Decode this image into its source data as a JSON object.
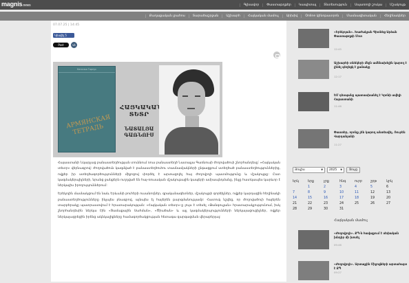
{
  "site": {
    "logo": "magnis",
    "logo_suffix": ".news"
  },
  "top_nav": [
    "Գլխավոր",
    "Փաստաթղթեր",
    "Կապիտալ",
    "Տնտեսություն",
    "Սպառողի շուկա",
    "Մշակույթ"
  ],
  "sub_nav": [
    "Քաղաքական լրահոս",
    "Տարածաշրջան",
    "Աշխարհ",
    "Հայկական մամուլ",
    "Արխիվ",
    "Online կինոթատրոն",
    "Մասնագիտական",
    "Հեղինակներ"
  ],
  "article": {
    "date": "07.07.25 | 14:45",
    "share": {
      "fb": "Կիսվել 5",
      "x": "Post",
      "vk": "vk"
    },
    "hero": {
      "book_author": "Наталья Гарнус",
      "book_title": "АРМЯНСКАЯ ТЕТРАДЬ",
      "armenian_line1": "ՀԱՅԿԱԿԱՆ",
      "armenian_line2": "ՏԵՏՐ",
      "armenian_line3": "ՆԱՏԱԼՅԱ",
      "armenian_line4": "ԳԱՌՆՈՒՍ"
    },
    "paragraphs": [
      "Հայաստանի Նկարչաց բանաստեղծության տուննում ռուս բանաստեղծ Նատալյա Գառնուսի ժողովածուի շնորհանդեսը՝ «Հայկական տետր» վերնագրով: Ժողովածուն կազմված է բանաստեղծուհու տասնամյակների ընթացքում ստեղծած բանաստեղծություններից, ովքեր իր ստեղծագործությունների միջոցով փորձել է արտացոլել հայ ժողովրդի պատմությունը և մշակույթը: Ըստ կազմակերպիչների, նրանց ջանքերն ուղղված են հայ-ռուսական մշակութային կապերի ամրապնդմանը, ինչը հատկապես կարևոր է ներկայիս իրողություններում:",
      "Երեկոյին մասնակցում են նաև Երևանի բուհերի ուսանողներ, գրականագետներ, մշակույթի գործիչներ, ովքեր կարդացին հեղինակի բանաստեղծությունները ինչպես բնագրով, այնպես էլ հայերեն թարգմանությամբ: Հատուկ նշվեց, որ ժողովածուի հայերեն տարբերակը պատրաստվում է հրատարակության: «Հայկական տետր»-ը լույս է տեսել «Ջանգուլյան» հրատարակչությունում, իսկ շնորհանդեսին ներկա էին «Ցամաքային Սահման», «Ծիածան» և այլ կազմակերպությունների ներկայացուցիչներ, ովքեր ներկայացրեցին իրենց ակնկալիքները համագործակցության հետագա զարգացման վերաբերյալ:"
    ]
  },
  "sidebar_news": [
    {
      "title": "«Երեկոյան». Խաժակյան Գիտնեց Արձան Փաստաթղթի Մոտ",
      "time": "12:45"
    },
    {
      "title": "Աշխարհի տնեկերի մեջն ամենախելին կարող է լինել գեղեցկ է քանակը",
      "time": "12:17"
    },
    {
      "title": "ԵՄ դեսպանը պատասխանել է Կրոնի ավելի Հայաստանի",
      "time": "11:46"
    },
    {
      "title": "Փաստեր, որոնք չեն կարող անտեսվել. Ռուբեն Վարդանյանի",
      "time": "11:27"
    }
  ],
  "archive_filter": {
    "month": "Յուլիս",
    "year": "2025",
    "button": "Ցույց"
  },
  "calendar": {
    "weekdays": [
      "երկ",
      "երք",
      "չրք",
      "հնգ",
      "ուրբ",
      "շբթ",
      "կրկ"
    ],
    "weeks": [
      [
        "",
        "1",
        "2",
        "3",
        "4",
        "5",
        "6"
      ],
      [
        "7",
        "8",
        "9",
        "10",
        "11",
        "12",
        "13"
      ],
      [
        "14",
        "15",
        "16",
        "17",
        "18",
        "19",
        "20"
      ],
      [
        "21",
        "22",
        "23",
        "24",
        "25",
        "26",
        "27"
      ],
      [
        "28",
        "29",
        "30",
        "31",
        "",
        "",
        ""
      ]
    ],
    "linked_days": [
      "1",
      "2",
      "3",
      "4",
      "5",
      "7",
      "8",
      "9",
      "10",
      "11",
      "14",
      "15",
      "16",
      "17",
      "18"
    ]
  },
  "section2": {
    "title": "Հայկական մամուլ"
  },
  "sidebar_news2": [
    {
      "title": "«Ժողովրդի»․ ՔՊ-ն հավաքում է սեփական խնդիր մի խոսել",
      "time": "09:46"
    },
    {
      "title": "«Ժողովրդի»․ Արտաքին Միջոցների արտահայտ է ՔՊ",
      "time": "09:27"
    }
  ],
  "colors": {
    "topbar": "#4d4d4d",
    "subbar": "#808080",
    "link": "#2a57b5",
    "fb": "#3b5998"
  }
}
